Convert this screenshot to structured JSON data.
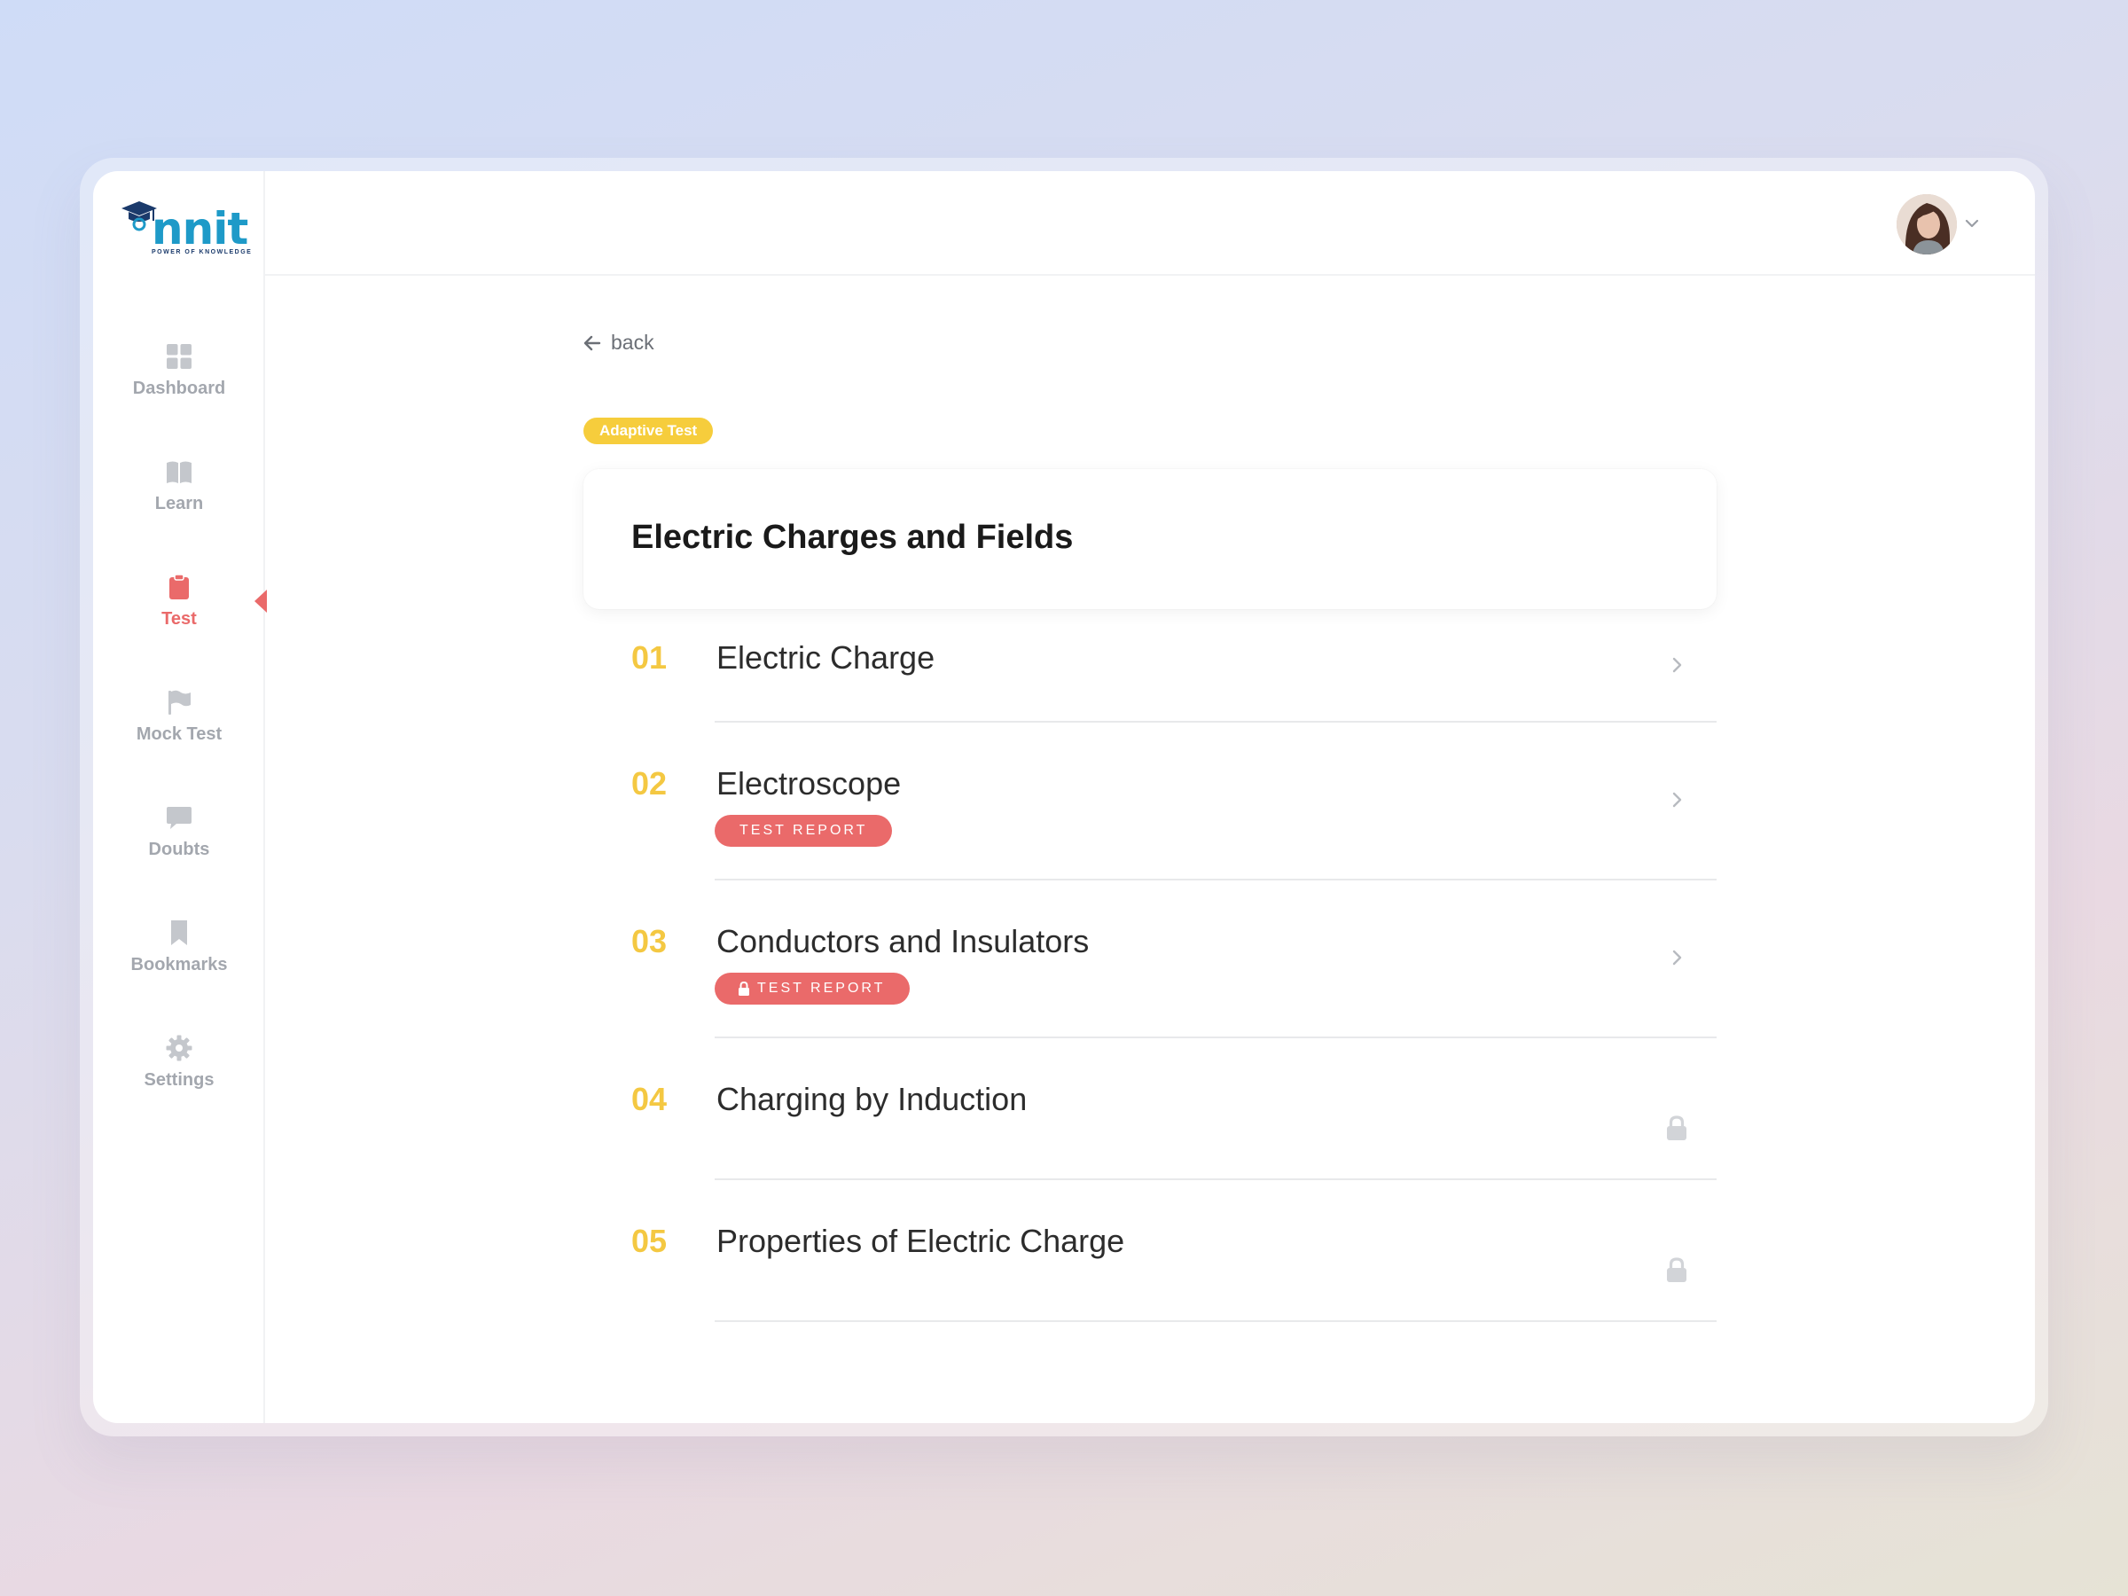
{
  "brand": {
    "name": "nnit",
    "tagline": "POWER OF KNOWLEDGE"
  },
  "sidebar": {
    "items": [
      {
        "label": "Dashboard",
        "icon": "grid-icon",
        "active": false
      },
      {
        "label": "Learn",
        "icon": "book-icon",
        "active": false
      },
      {
        "label": "Test",
        "icon": "clipboard-icon",
        "active": true
      },
      {
        "label": "Mock Test",
        "icon": "flag-icon",
        "active": false
      },
      {
        "label": "Doubts",
        "icon": "chat-bubble-icon",
        "active": false
      },
      {
        "label": "Bookmarks",
        "icon": "bookmark-icon",
        "active": false
      },
      {
        "label": "Settings",
        "icon": "gear-icon",
        "active": false
      }
    ]
  },
  "main": {
    "back_label": "back",
    "tag_label": "Adaptive Test",
    "title": "Electric Charges and Fields",
    "topics": [
      {
        "num": "01",
        "name": "Electric Charge",
        "badge": "",
        "locked": false
      },
      {
        "num": "02",
        "name": "Electroscope",
        "badge": "TEST REPORT",
        "badge_locked": false,
        "locked": false
      },
      {
        "num": "03",
        "name": "Conductors and Insulators",
        "badge": "TEST REPORT",
        "badge_locked": true,
        "locked": false
      },
      {
        "num": "04",
        "name": "Charging by Induction",
        "badge": "",
        "locked": true
      },
      {
        "num": "05",
        "name": "Properties of Electric Charge",
        "badge": "",
        "locked": true
      }
    ]
  },
  "colors": {
    "accent_red": "#ea6a6a",
    "accent_yellow": "#f4c842",
    "nav_gray": "#a3a7ae"
  }
}
